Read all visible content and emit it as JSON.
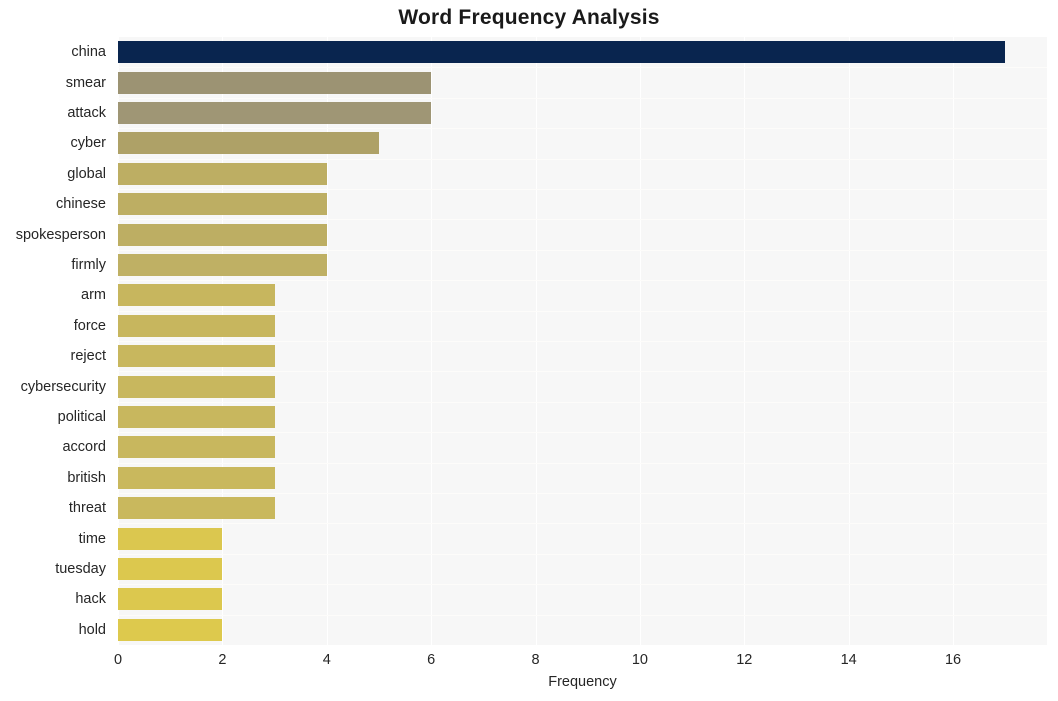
{
  "chart_data": {
    "type": "bar",
    "orientation": "horizontal",
    "title": "Word Frequency Analysis",
    "xlabel": "Frequency",
    "ylabel": "",
    "categories": [
      "china",
      "smear",
      "attack",
      "cyber",
      "global",
      "chinese",
      "spokesperson",
      "firmly",
      "arm",
      "force",
      "reject",
      "cybersecurity",
      "political",
      "accord",
      "british",
      "threat",
      "time",
      "tuesday",
      "hack",
      "hold"
    ],
    "values": [
      17,
      6,
      6,
      5,
      4,
      4,
      4,
      4,
      3,
      3,
      3,
      3,
      3,
      3,
      3,
      3,
      2,
      2,
      2,
      2
    ],
    "xticks": [
      0,
      2,
      4,
      6,
      8,
      10,
      12,
      14,
      16
    ],
    "xlim": [
      0,
      17.8
    ],
    "grid": true,
    "legend": null,
    "bar_colors": [
      "#09254f",
      "#9c9373",
      "#9f9675",
      "#aea167",
      "#bdae63",
      "#bdae63",
      "#bdae63",
      "#bfb064",
      "#c7b65e",
      "#c7b65e",
      "#c8b75e",
      "#c8b75e",
      "#c8b75e",
      "#c8b75e",
      "#c9b85d",
      "#c9b85d",
      "#dbc74f",
      "#dcc84e",
      "#dcc84e",
      "#ddc94d"
    ],
    "plot_background": "#f7f7f7",
    "figure_background": "#ffffff",
    "grid_color": "#ffffff",
    "text_color": "#262626"
  }
}
